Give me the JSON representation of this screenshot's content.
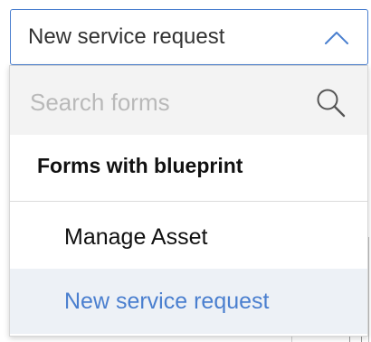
{
  "select": {
    "value": "New service request",
    "icon": "chevron-up-icon",
    "accent_color": "#4a7fcf"
  },
  "dropdown": {
    "search": {
      "placeholder": "Search forms",
      "value": "",
      "icon": "search-icon"
    },
    "group_label": "Forms with blueprint",
    "options": [
      {
        "label": "Manage Asset",
        "selected": false
      },
      {
        "label": "New service request",
        "selected": true
      }
    ]
  },
  "colors": {
    "selected_text": "#4a7fcf",
    "selected_background": "#edf1f6",
    "search_background": "#f3f3f3"
  }
}
